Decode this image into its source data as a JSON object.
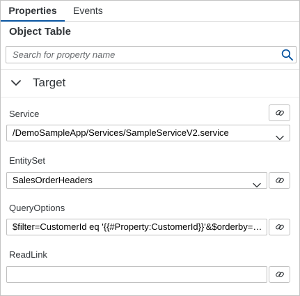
{
  "tabs": [
    {
      "label": "Properties",
      "active": true
    },
    {
      "label": "Events",
      "active": false
    }
  ],
  "panel_title": "Object Table",
  "search": {
    "placeholder": "Search for property name",
    "value": ""
  },
  "section": {
    "label": "Target",
    "expanded": true
  },
  "fields": {
    "service": {
      "label": "Service",
      "value": "/DemoSampleApp/Services/SampleServiceV2.service"
    },
    "entityset": {
      "label": "EntitySet",
      "value": "SalesOrderHeaders"
    },
    "queryoptions": {
      "label": "QueryOptions",
      "value": "$filter=CustomerId eq '{{#Property:CustomerId}}'&$orderby=CreatedAt desc"
    },
    "readlink": {
      "label": "ReadLink",
      "value": ""
    }
  },
  "colors": {
    "accent": "#0854a0",
    "border": "#bfbfbf",
    "text": "#32363a"
  },
  "icons": {
    "search": "search-icon",
    "chevron": "chevron-down-icon",
    "dropdown": "dropdown-arrow-icon",
    "link": "link-icon"
  }
}
